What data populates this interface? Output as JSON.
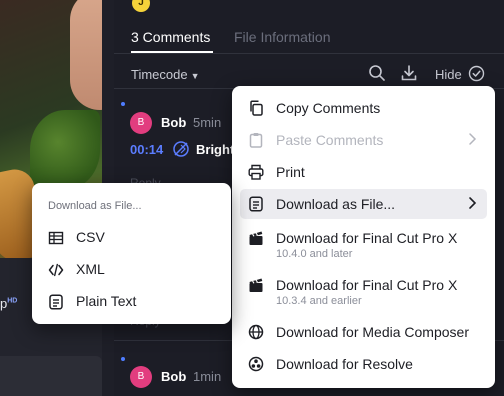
{
  "header": {
    "avatar_initial": "J",
    "tabs": [
      {
        "label": "3 Comments",
        "active": true
      },
      {
        "label": "File Information",
        "active": false
      }
    ],
    "sort_label": "Timecode",
    "hide_label": "Hide"
  },
  "left": {
    "player_label": "p",
    "player_badge": "HD"
  },
  "comments": [
    {
      "initial": "B",
      "author": "Bob",
      "time": "5min",
      "timecode": "00:14",
      "text": "Bright",
      "reply": "Reply"
    },
    {
      "initial": "B",
      "author": "Bob",
      "time": "1min",
      "reply": "Reply"
    }
  ],
  "context_menu": {
    "items": [
      {
        "label": "Copy Comments",
        "icon": "copy-icon",
        "disabled": false
      },
      {
        "label": "Paste Comments",
        "icon": "clipboard-icon",
        "disabled": true,
        "submenu": true
      },
      {
        "label": "Print",
        "icon": "printer-icon",
        "disabled": false
      },
      {
        "label": "Download as File...",
        "icon": "file-text-icon",
        "disabled": false,
        "submenu": true,
        "highlighted": true
      },
      {
        "label": "Download for Final Cut Pro X",
        "sublabel": "10.4.0 and later",
        "icon": "clapperboard-icon"
      },
      {
        "label": "Download for Final Cut Pro X",
        "sublabel": "10.3.4 and earlier",
        "icon": "clapperboard-icon"
      },
      {
        "label": "Download for Media Composer",
        "icon": "media-composer-icon"
      },
      {
        "label": "Download for Resolve",
        "icon": "resolve-icon"
      }
    ]
  },
  "submenu": {
    "title": "Download as File...",
    "items": [
      {
        "label": "CSV",
        "icon": "table-icon"
      },
      {
        "label": "XML",
        "icon": "code-icon"
      },
      {
        "label": "Plain Text",
        "icon": "file-text-icon"
      }
    ]
  },
  "colors": {
    "accent": "#5b7dff",
    "avatar_bob": "#e23d7f",
    "avatar_top": "#f5d33a",
    "panel_bg": "#1c1d26"
  }
}
